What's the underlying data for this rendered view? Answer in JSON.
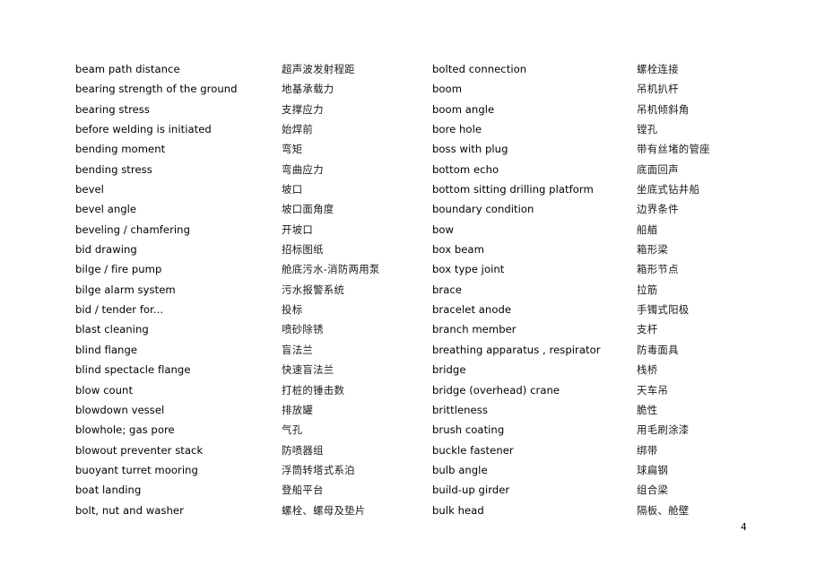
{
  "document": {
    "type": "bilingual-glossary",
    "page_number": "4",
    "columns": [
      "english",
      "chinese",
      "english",
      "chinese"
    ]
  },
  "entries_left": [
    {
      "en": "beam path distance",
      "zh": "超声波发射程距"
    },
    {
      "en": "bearing strength of the ground",
      "zh": "地基承载力"
    },
    {
      "en": "bearing stress",
      "zh": "支撑应力"
    },
    {
      "en": "before welding is initiated",
      "zh": "始焊前"
    },
    {
      "en": "bending moment",
      "zh": "弯矩"
    },
    {
      "en": "bending stress",
      "zh": "弯曲应力"
    },
    {
      "en": "bevel",
      "zh": "坡口"
    },
    {
      "en": "bevel angle",
      "zh": "坡口面角度"
    },
    {
      "en": "beveling / chamfering",
      "zh": "开坡口"
    },
    {
      "en": "bid drawing",
      "zh": "招标图纸"
    },
    {
      "en": "bilge / fire pump",
      "zh": "舱底污水-消防两用泵"
    },
    {
      "en": "bilge alarm system",
      "zh": "污水报警系统"
    },
    {
      "en": "bid / tender for...",
      "zh": "投标"
    },
    {
      "en": "blast cleaning",
      "zh": "喷砂除锈"
    },
    {
      "en": "blind flange",
      "zh": "盲法兰"
    },
    {
      "en": "blind spectacle flange",
      "zh": "快速盲法兰"
    },
    {
      "en": "blow count",
      "zh": "打桩的锤击数"
    },
    {
      "en": "blowdown vessel",
      "zh": "排放罐"
    },
    {
      "en": "blowhole; gas pore",
      "zh": "气孔"
    },
    {
      "en": "blowout preventer stack",
      "zh": "防喷器组"
    },
    {
      "en": "buoyant turret mooring",
      "zh": "浮筒转塔式系泊"
    },
    {
      "en": "boat landing",
      "zh": "登船平台"
    },
    {
      "en": "bolt, nut and washer",
      "zh": "螺栓、螺母及垫片"
    }
  ],
  "entries_right": [
    {
      "en": "bolted connection",
      "zh": "螺栓连接"
    },
    {
      "en": "boom",
      "zh": "吊机扒杆"
    },
    {
      "en": "boom angle",
      "zh": "吊机倾斜角"
    },
    {
      "en": "bore hole",
      "zh": "镗孔"
    },
    {
      "en": "boss with plug",
      "zh": "带有丝堵的管座"
    },
    {
      "en": "bottom echo",
      "zh": "底面回声"
    },
    {
      "en": "bottom sitting drilling platform",
      "zh": "坐底式钻井船"
    },
    {
      "en": "boundary condition",
      "zh": "边界条件"
    },
    {
      "en": "bow",
      "zh": "船艏"
    },
    {
      "en": "box beam",
      "zh": "箱形梁"
    },
    {
      "en": "box type joint",
      "zh": "箱形节点"
    },
    {
      "en": "brace",
      "zh": "拉筋"
    },
    {
      "en": "bracelet anode",
      "zh": "手镯式阳极"
    },
    {
      "en": "branch member",
      "zh": "支杆"
    },
    {
      "en": "breathing apparatus , respirator",
      "zh": "防毒面具"
    },
    {
      "en": "bridge",
      "zh": "栈桥"
    },
    {
      "en": "bridge (overhead) crane",
      "zh": "天车吊"
    },
    {
      "en": "brittleness",
      "zh": "脆性"
    },
    {
      "en": "brush coating",
      "zh": "用毛刷涂漆"
    },
    {
      "en": "buckle fastener",
      "zh": "绑带"
    },
    {
      "en": "bulb angle",
      "zh": "球扁钢"
    },
    {
      "en": "build-up girder",
      "zh": "组合梁"
    },
    {
      "en": "bulk head",
      "zh": "隔板、舱壁"
    }
  ]
}
